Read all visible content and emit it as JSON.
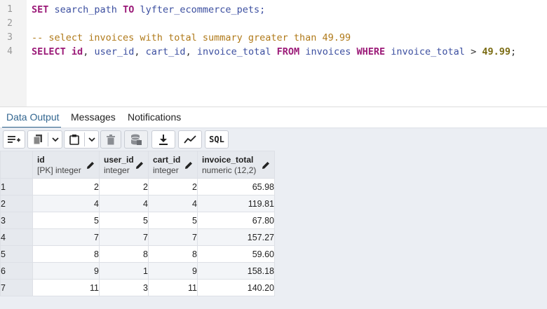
{
  "editor": {
    "line_numbers": [
      "1",
      "2",
      "3",
      "4"
    ],
    "line1": {
      "kw1": "SET",
      "ident": "search_path",
      "kw2": "TO",
      "value": "lyfter_ecommerce_pets;"
    },
    "line3": {
      "comment": "-- select invoices with total summary greater than 49.99"
    },
    "line4": {
      "kw_select": "SELECT",
      "col_id": "id",
      "comma1": ",",
      "col_user": "user_id",
      "comma2": ",",
      "col_cart": "cart_id",
      "comma3": ",",
      "col_total": "invoice_total",
      "kw_from": "FROM",
      "table": "invoices",
      "kw_where": "WHERE",
      "where_col": "invoice_total",
      "op": ">",
      "num": "49.99",
      "semi": ";"
    }
  },
  "tabs": [
    "Data Output",
    "Messages",
    "Notifications"
  ],
  "toolbar": {
    "sql_label": "SQL",
    "icons": [
      "add-row-icon",
      "copy-icon",
      "chevron-down-icon",
      "paste-icon",
      "chevron-down-icon",
      "delete-icon",
      "save-data-icon",
      "download-icon",
      "graph-icon",
      "sql-icon"
    ]
  },
  "grid": {
    "columns": [
      {
        "name": "id",
        "type": "[PK] integer"
      },
      {
        "name": "user_id",
        "type": "integer"
      },
      {
        "name": "cart_id",
        "type": "integer"
      },
      {
        "name": "invoice_total",
        "type": "numeric (12,2)"
      }
    ],
    "rows": [
      {
        "n": "1",
        "cells": [
          "2",
          "2",
          "2",
          "65.98"
        ]
      },
      {
        "n": "2",
        "cells": [
          "4",
          "4",
          "4",
          "119.81"
        ]
      },
      {
        "n": "3",
        "cells": [
          "5",
          "5",
          "5",
          "67.80"
        ]
      },
      {
        "n": "4",
        "cells": [
          "7",
          "7",
          "7",
          "157.27"
        ]
      },
      {
        "n": "5",
        "cells": [
          "8",
          "8",
          "8",
          "59.60"
        ]
      },
      {
        "n": "6",
        "cells": [
          "9",
          "1",
          "9",
          "158.18"
        ]
      },
      {
        "n": "7",
        "cells": [
          "11",
          "3",
          "11",
          "140.20"
        ]
      }
    ]
  }
}
